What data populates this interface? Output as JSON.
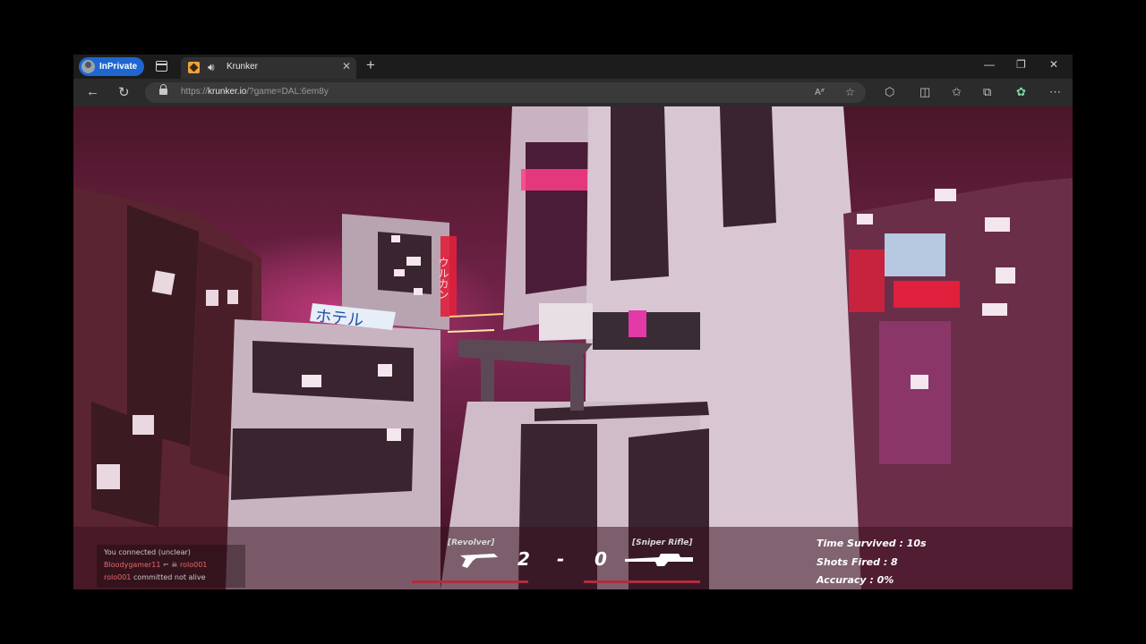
{
  "browser": {
    "inprivate_label": "InPrivate",
    "tab_title": "Krunker",
    "url_prefix": "https://",
    "url_domain": "krunker.io",
    "url_path": "/?game=DAL:6em8y",
    "icons": {
      "tabs": "tab-actions-icon",
      "speaker": "speaker-icon",
      "close": "close-icon",
      "new_tab": "plus-icon",
      "back": "back-arrow-icon",
      "refresh": "refresh-icon",
      "lock": "lock-icon",
      "read_aloud": "read-aloud-icon",
      "favorite": "star-icon",
      "extensions": "puzzle-icon",
      "split": "split-screen-icon",
      "favorites": "favorites-icon",
      "collections": "collections-icon",
      "copilot": "copilot-icon",
      "menu": "more-icon"
    }
  },
  "game": {
    "sign_hotel": "ホテル",
    "sign_vertical": "ウルカン",
    "hud": {
      "left_weapon": "[Revolver]",
      "right_weapon": "[Sniper Rifle]",
      "score_left": "2",
      "score_sep": "-",
      "score_right": "0",
      "time_survived": "Time Survived : 10s",
      "shots_fired": "Shots Fired : 8",
      "accuracy": "Accuracy : 0%"
    },
    "killfeed": [
      {
        "a": "You",
        "b": "connected (unclear)"
      },
      {
        "a": "Bloodygamer11",
        "b": "rolo001"
      },
      {
        "a": "rolo001",
        "b": "committed not alive"
      }
    ],
    "colors": {
      "fog": "#5a1b33",
      "neon_pink": "#ff3d8a",
      "neon_red": "#e0203c",
      "building": "#d8c7d2"
    }
  }
}
